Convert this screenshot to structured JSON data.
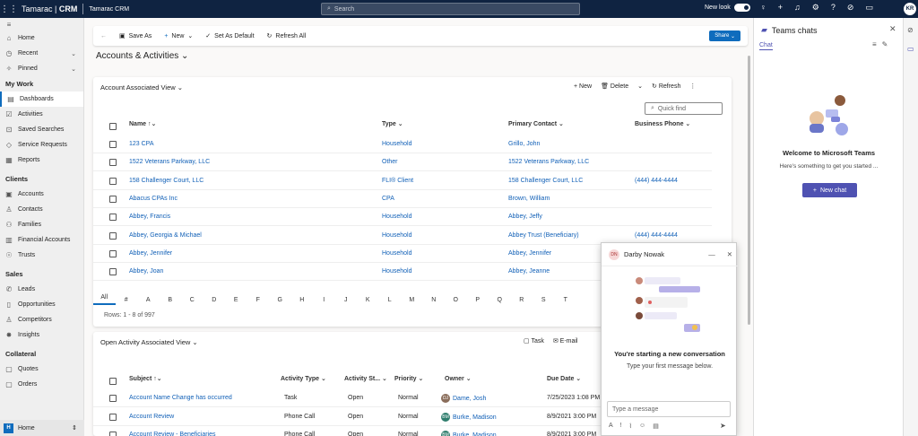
{
  "topbar": {
    "brand_name": "Tamarac",
    "brand_crm": "CRM",
    "app_name": "Tamarac CRM",
    "search_placeholder": "Search",
    "new_look_label": "New look",
    "user_initials": "KR"
  },
  "sidebar": {
    "top_items": [
      {
        "label": "Home",
        "icon": "home-icon"
      },
      {
        "label": "Recent",
        "icon": "clock-icon"
      },
      {
        "label": "Pinned",
        "icon": "pin-icon"
      }
    ],
    "sections": [
      {
        "title": "My Work",
        "items": [
          "Dashboards",
          "Activities",
          "Saved Searches",
          "Service Requests",
          "Reports"
        ]
      },
      {
        "title": "Clients",
        "items": [
          "Accounts",
          "Contacts",
          "Families",
          "Financial Accounts",
          "Trusts"
        ]
      },
      {
        "title": "Sales",
        "items": [
          "Leads",
          "Opportunities",
          "Competitors",
          "Insights"
        ]
      },
      {
        "title": "Collateral",
        "items": [
          "Quotes",
          "Orders"
        ]
      }
    ],
    "active_item": "Dashboards",
    "area_badge": "H",
    "area_label": "Home"
  },
  "commandbar": {
    "save_as": "Save As",
    "new": "New",
    "set_as_default": "Set As Default",
    "refresh_all": "Refresh All",
    "share": "Share"
  },
  "page_title": "Accounts & Activities",
  "accounts_view": {
    "title": "Account Associated View",
    "new": "New",
    "delete": "Delete",
    "refresh": "Refresh",
    "quick_find_placeholder": "Quick find",
    "columns": [
      "Name",
      "Type",
      "Primary Contact",
      "Business Phone"
    ],
    "rows": [
      {
        "name": "123 CPA",
        "type": "Household",
        "contact": "Grillo, John",
        "phone": ""
      },
      {
        "name": "1522 Veterans Parkway, LLC",
        "type": "Other",
        "contact": "1522 Veterans Parkway, LLC",
        "phone": ""
      },
      {
        "name": "158 Challenger Court, LLC",
        "type": "FLI® Client",
        "contact": "158 Challenger Court, LLC",
        "phone": "(444) 444-4444"
      },
      {
        "name": "Abacus CPAs Inc",
        "type": "CPA",
        "contact": "Brown, William",
        "phone": ""
      },
      {
        "name": "Abbey, Francis",
        "type": "Household",
        "contact": "Abbey, Jeffy",
        "phone": ""
      },
      {
        "name": "Abbey, Georgia & Michael",
        "type": "Household",
        "contact": "Abbey Trust (Beneficiary)",
        "phone": "(444) 444-4444"
      },
      {
        "name": "Abbey, Jennifer",
        "type": "Household",
        "contact": "Abbey, Jennifer",
        "phone": ""
      },
      {
        "name": "Abbey, Joan",
        "type": "Household",
        "contact": "Abbey, Jeanne",
        "phone": ""
      }
    ],
    "alphabet": [
      "All",
      "#",
      "A",
      "B",
      "C",
      "D",
      "E",
      "F",
      "G",
      "H",
      "I",
      "J",
      "K",
      "L",
      "M",
      "N",
      "O",
      "P",
      "Q",
      "R",
      "S",
      "T"
    ],
    "row_count": "Rows: 1 - 8 of 997"
  },
  "activities_view": {
    "title": "Open Activity Associated View",
    "task": "Task",
    "email": "E-mail",
    "columns": [
      "Subject",
      "Activity Type",
      "Activity St...",
      "Priority",
      "Owner",
      "Due Date"
    ],
    "rows": [
      {
        "subject": "Account Name Change has occurred",
        "type": "Task",
        "status": "Open",
        "priority": "Normal",
        "owner_initials": "DJ",
        "owner": "Dame, Josh",
        "owner_color": "#8a6d5b",
        "due": "7/25/2023 1:08 PM"
      },
      {
        "subject": "Account Review",
        "type": "Phone Call",
        "status": "Open",
        "priority": "Normal",
        "owner_initials": "BM",
        "owner": "Burke, Madison",
        "owner_color": "#2f7d6d",
        "due": "8/9/2021 3:00 PM"
      },
      {
        "subject": "Account Review - Beneficiaries",
        "type": "Phone Call",
        "status": "Open",
        "priority": "Normal",
        "owner_initials": "BM",
        "owner": "Burke, Madison",
        "owner_color": "#2f7d6d",
        "due": "8/9/2021 3:00 PM"
      }
    ]
  },
  "teams": {
    "title": "Teams chats",
    "tab": "Chat",
    "welcome": "Welcome to Microsoft Teams",
    "welcome_sub": "Here's something to get you started ...",
    "new_chat": "New chat"
  },
  "chat_popup": {
    "initials": "DN",
    "name": "Darby Nowak",
    "starting": "You're starting a new conversation",
    "sub": "Type your first message below.",
    "input_placeholder": "Type a message"
  },
  "colors": {
    "topbar": "#0f2341",
    "accent": "#0f6cbd",
    "teams": "#4f52b2",
    "link": "#1160b7"
  }
}
